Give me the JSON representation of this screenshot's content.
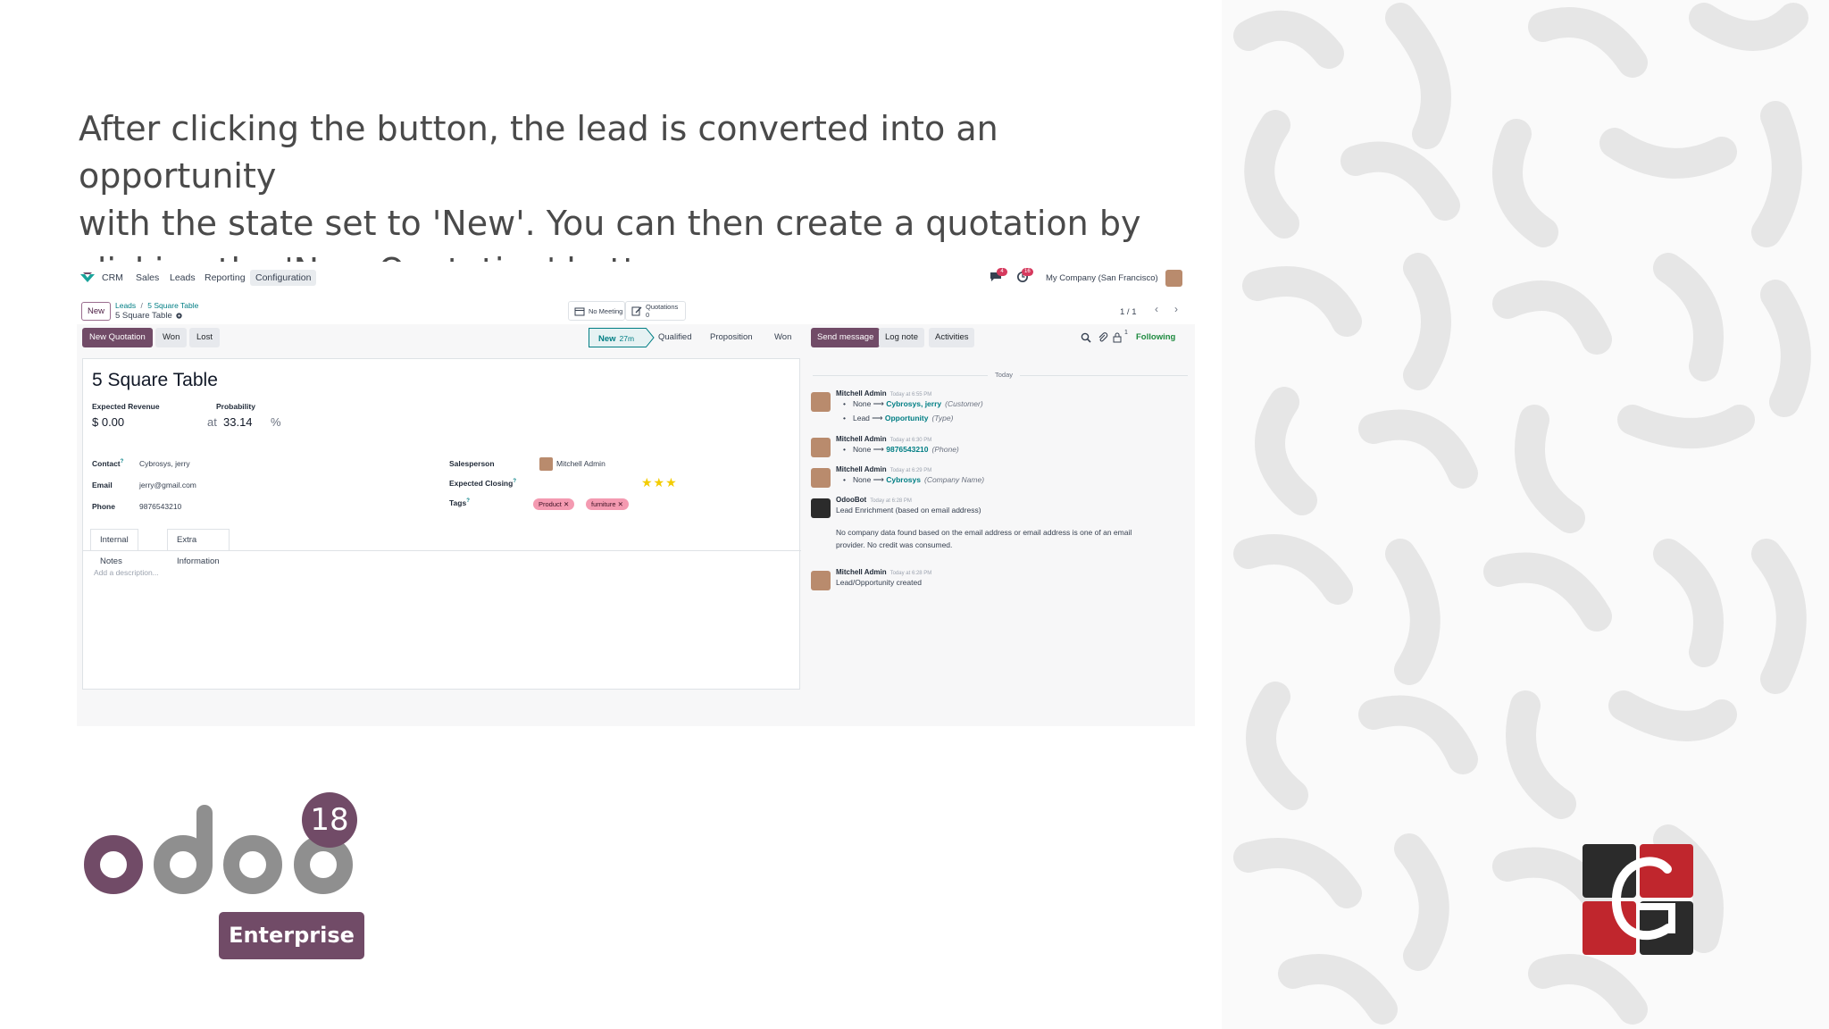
{
  "headline": {
    "line1": "After clicking the button, the lead is converted into an opportunity",
    "line2": "with the state set to 'New'. You can then create a quotation by",
    "line3": "clicking the 'New Quotation' button."
  },
  "topbar": {
    "app": "CRM",
    "menu": [
      "Sales",
      "Leads",
      "Reporting",
      "Configuration"
    ],
    "company": "My Company (San Francisco)",
    "chat_badge": "4",
    "activity_badge": "16"
  },
  "control_panel": {
    "new_label": "New",
    "breadcrumb_parent": "Leads",
    "breadcrumb_sep": "/",
    "breadcrumb_current": "5 Square Table",
    "record_name": "5 Square Table",
    "smart_meeting": "No Meeting",
    "smart_quotations_label": "Quotations",
    "smart_quotations_count": "0",
    "pager": "1 / 1"
  },
  "form_actions": {
    "new_quotation": "New Quotation",
    "won": "Won",
    "lost": "Lost"
  },
  "stages": {
    "current": "New",
    "current_time": "27m",
    "others": [
      "Qualified",
      "Proposition",
      "Won"
    ]
  },
  "chatter_actions": {
    "send_message": "Send message",
    "log_note": "Log note",
    "activities": "Activities",
    "followers": "1",
    "following": "Following"
  },
  "form": {
    "title": "5 Square Table",
    "expected_revenue_label": "Expected Revenue",
    "expected_revenue": "$ 0.00",
    "probability_label": "Probability",
    "at": "at",
    "probability": "33.14",
    "percent": "%",
    "contact_label": "Contact",
    "contact": "Cybrosys, jerry",
    "email_label": "Email",
    "email": "jerry@gmail.com",
    "phone_label": "Phone",
    "phone": "9876543210",
    "salesperson_label": "Salesperson",
    "salesperson": "Mitchell Admin",
    "expected_closing_label": "Expected Closing",
    "tags_label": "Tags",
    "tags": [
      "Product",
      "furniture"
    ],
    "priority_stars": 3,
    "tab_internal": "Internal Notes",
    "tab_extra": "Extra Information",
    "description_placeholder": "Add a description..."
  },
  "chatter": {
    "today": "Today",
    "messages": [
      {
        "author": "Mitchell Admin",
        "time": "Today at 6:55 PM",
        "changes": [
          {
            "old": "None",
            "new": "Cybrosys, jerry",
            "field": "(Customer)"
          },
          {
            "old": "Lead",
            "new": "Opportunity",
            "field": "(Type)"
          }
        ]
      },
      {
        "author": "Mitchell Admin",
        "time": "Today at 6:30 PM",
        "changes": [
          {
            "old": "None",
            "new": "9876543210",
            "field": "(Phone)"
          }
        ]
      },
      {
        "author": "Mitchell Admin",
        "time": "Today at 6:29 PM",
        "changes": [
          {
            "old": "None",
            "new": "Cybrosys",
            "field": "(Company Name)"
          }
        ]
      },
      {
        "author": "OdooBot",
        "time": "Today at 6:28 PM",
        "text1": "Lead Enrichment (based on email address)",
        "text2": "No company data found based on the email address or email address is one of an email",
        "text3": "provider. No credit was consumed."
      },
      {
        "author": "Mitchell Admin",
        "time": "Today at 6:28 PM",
        "text1": "Lead/Opportunity created"
      }
    ]
  },
  "branding": {
    "version": "18",
    "edition": "Enterprise",
    "accent": "#714b67"
  }
}
